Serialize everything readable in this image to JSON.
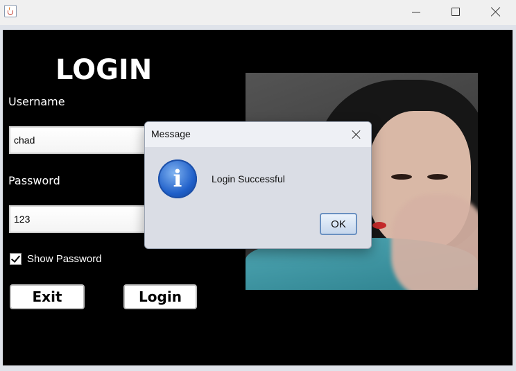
{
  "window": {
    "app_icon": "java-cup-icon"
  },
  "login_form": {
    "title": "LOGIN",
    "username_label": "Username",
    "username_value": "chad",
    "password_label": "Password",
    "password_value": "123",
    "show_password_label": "Show Password",
    "show_password_checked": true,
    "exit_button": "Exit",
    "login_button": "Login"
  },
  "dialog": {
    "title": "Message",
    "icon": "info-icon",
    "message": "Login Successful",
    "ok_button": "OK"
  },
  "colors": {
    "background": "#000000",
    "dialog_background": "#dadde5",
    "info_icon": "#1f5fc9"
  }
}
